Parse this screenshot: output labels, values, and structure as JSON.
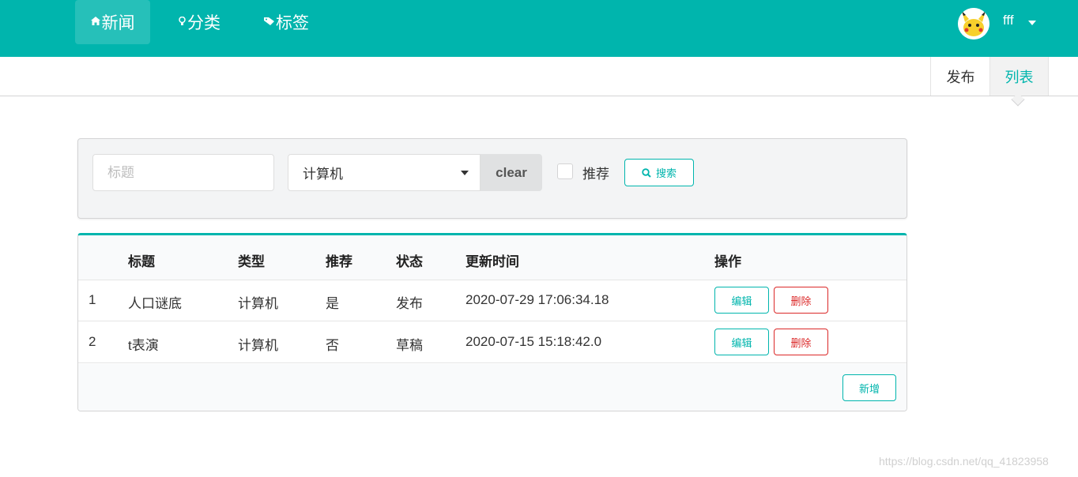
{
  "nav": {
    "items": [
      {
        "label": "新闻",
        "icon": "home-icon"
      },
      {
        "label": "分类",
        "icon": "idea-icon"
      },
      {
        "label": "标签",
        "icon": "tag-icon"
      }
    ],
    "username": "fff"
  },
  "submenu": {
    "publish": "发布",
    "list": "列表"
  },
  "search": {
    "title_placeholder": "标题",
    "type_value": "计算机",
    "clear_label": "clear",
    "recommend_label": "推荐",
    "search_label": "搜索"
  },
  "table": {
    "headers": [
      "标题",
      "类型",
      "推荐",
      "状态",
      "更新时间",
      "操作"
    ],
    "rows": [
      {
        "index": "1",
        "title": "人口谜底",
        "type": "计算机",
        "recommend": "是",
        "status": "发布",
        "updated": "2020-07-29 17:06:34.18"
      },
      {
        "index": "2",
        "title": "t表演",
        "type": "计算机",
        "recommend": "否",
        "status": "草稿",
        "updated": "2020-07-15 15:18:42.0"
      }
    ],
    "edit_label": "编辑",
    "delete_label": "删除",
    "add_label": "新增"
  },
  "watermark": "https://blog.csdn.net/qq_41823958",
  "colors": {
    "accent": "#00b5ad",
    "danger": "#db2828"
  }
}
